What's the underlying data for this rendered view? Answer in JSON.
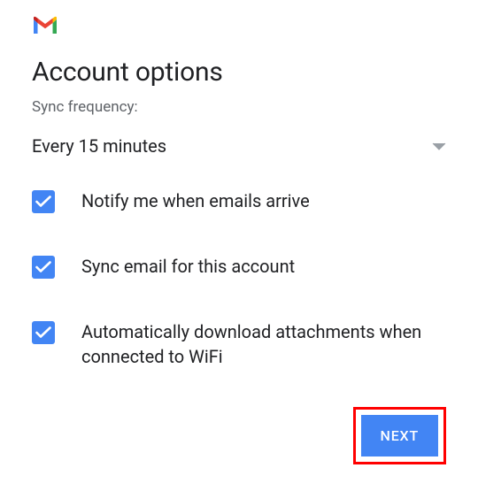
{
  "logo": "gmail",
  "title": "Account options",
  "subtitle": "Sync frequency:",
  "sync_select": {
    "value": "Every 15 minutes"
  },
  "options": [
    {
      "label": "Notify me when emails arrive",
      "checked": true
    },
    {
      "label": "Sync email for this account",
      "checked": true
    },
    {
      "label": "Automatically download attachments when connected to WiFi",
      "checked": true
    }
  ],
  "actions": {
    "next_label": "NEXT"
  },
  "colors": {
    "accent": "#4285f4",
    "highlight": "#ff0000"
  }
}
